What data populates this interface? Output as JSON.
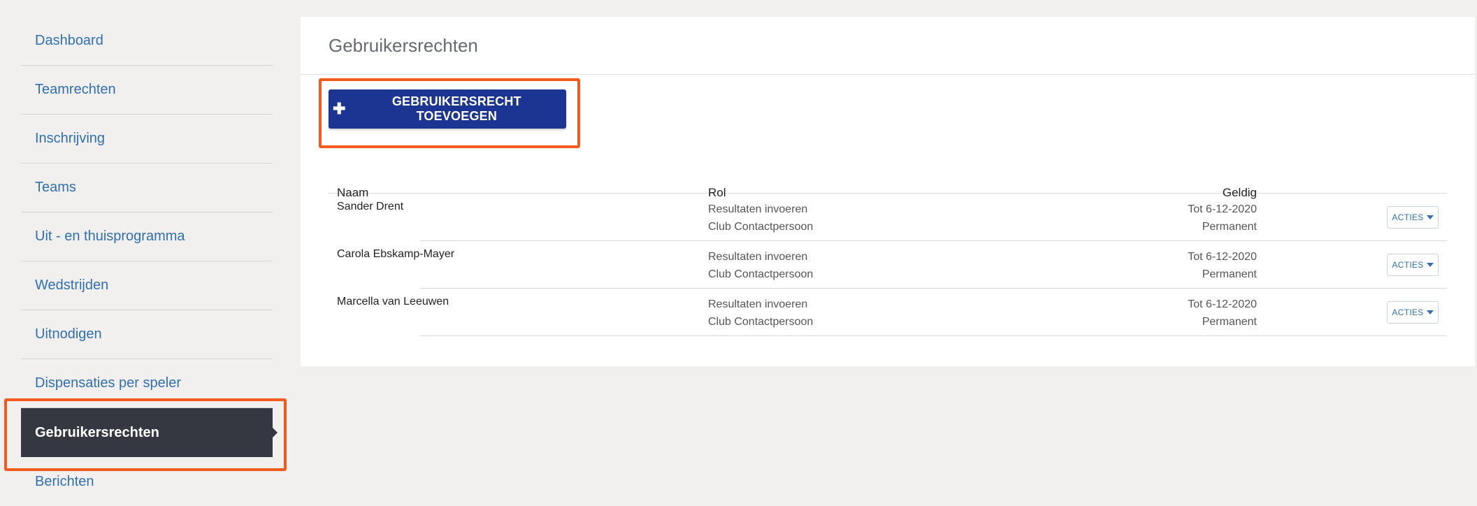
{
  "sidebar": {
    "items": [
      {
        "label": "Dashboard",
        "active": false
      },
      {
        "label": "Teamrechten",
        "active": false
      },
      {
        "label": "Inschrijving",
        "active": false
      },
      {
        "label": "Teams",
        "active": false
      },
      {
        "label": "Uit - en thuisprogramma",
        "active": false
      },
      {
        "label": "Wedstrijden",
        "active": false
      },
      {
        "label": "Uitnodigen",
        "active": false
      },
      {
        "label": "Dispensaties per speler",
        "active": false
      },
      {
        "label": "Gebruikersrechten",
        "active": true
      },
      {
        "label": "Berichten",
        "active": false
      }
    ]
  },
  "main": {
    "title": "Gebruikersrechten",
    "add_button_label": "GEBRUIKERSRECHT TOEVOEGEN",
    "table": {
      "headers": {
        "name": "Naam",
        "role": "Rol",
        "valid": "Geldig"
      },
      "rows": [
        {
          "name": "Sander Drent",
          "roles": [
            "Resultaten invoeren",
            "Club Contactpersoon"
          ],
          "valid": [
            "Tot 6-12-2020",
            "Permanent"
          ],
          "action": "ACTIES"
        },
        {
          "name": "Carola Ebskamp-Mayer",
          "roles": [
            "Resultaten invoeren",
            "Club Contactpersoon"
          ],
          "valid": [
            "Tot 6-12-2020",
            "Permanent"
          ],
          "action": "ACTIES"
        },
        {
          "name": "Marcella van Leeuwen",
          "roles": [
            "Resultaten invoeren",
            "Club Contactpersoon"
          ],
          "valid": [
            "Tot 6-12-2020",
            "Permanent"
          ],
          "action": "ACTIES"
        }
      ]
    }
  },
  "colors": {
    "primary_button": "#1d3592",
    "active_nav": "#353841",
    "link": "#2f6fb3",
    "highlight": "#f25a1e"
  }
}
